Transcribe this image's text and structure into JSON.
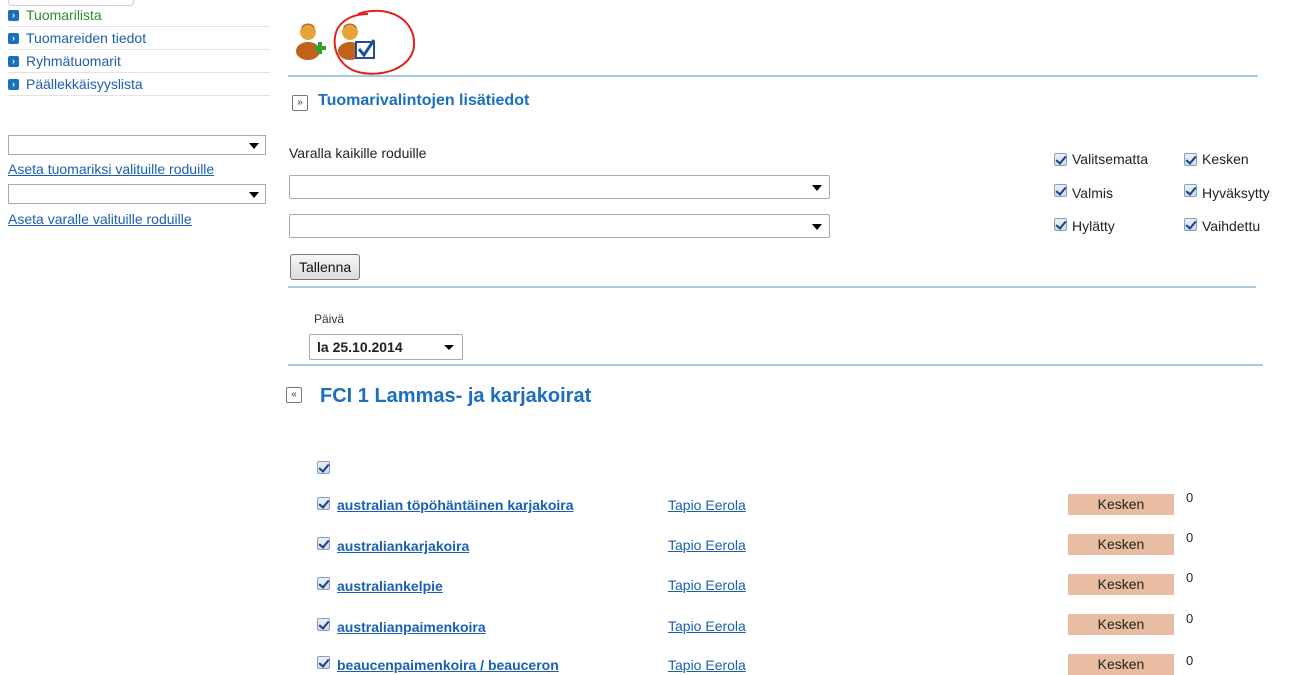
{
  "sidebar": {
    "items": [
      {
        "label": "Tuomarilista",
        "active": true
      },
      {
        "label": "Tuomareiden tiedot",
        "active": false
      },
      {
        "label": "Ryhmätuomarit",
        "active": false
      },
      {
        "label": "Päällekkäisyyslista",
        "active": false
      }
    ],
    "select1_value": "",
    "link1": "Aseta tuomariksi valituille roduille",
    "select2_value": "",
    "link2": "Aseta varalle valituille roduille"
  },
  "toolbar": {
    "icons": [
      "add-judge-icon",
      "judge-approve-icon"
    ]
  },
  "details": {
    "title": "Tuomarivalintojen lisätiedot",
    "reserve_label": "Varalla kaikille roduille",
    "select1_value": "",
    "select2_value": "",
    "save_label": "Tallenna"
  },
  "filters": [
    {
      "label": "Valitsematta",
      "checked": true
    },
    {
      "label": "Kesken",
      "checked": true
    },
    {
      "label": "Valmis",
      "checked": true
    },
    {
      "label": "Hyväksytty",
      "checked": true
    },
    {
      "label": "Hylätty",
      "checked": true
    },
    {
      "label": "Vaihdettu",
      "checked": true
    }
  ],
  "day": {
    "label": "Päivä",
    "value": "la 25.10.2014"
  },
  "group": {
    "title": "FCI 1 Lammas- ja karjakoirat",
    "rows": [
      {
        "breed": "australian töpöhäntäinen karjakoira",
        "judge": "Tapio Eerola",
        "status": "Kesken",
        "count": "0"
      },
      {
        "breed": "australiankarjakoira",
        "judge": "Tapio Eerola",
        "status": "Kesken",
        "count": "0"
      },
      {
        "breed": "australiankelpie",
        "judge": "Tapio Eerola",
        "status": "Kesken",
        "count": "0"
      },
      {
        "breed": "australianpaimenkoira",
        "judge": "Tapio Eerola",
        "status": "Kesken",
        "count": "0"
      },
      {
        "breed": "beaucenpaimenkoira / beauceron",
        "judge": "Tapio Eerola",
        "status": "Kesken",
        "count": "0"
      }
    ]
  },
  "colors": {
    "link": "#1a5fb4",
    "active_nav": "#2e8b2e",
    "divider": "#a9cbe6",
    "status_bg": "#e8bca0",
    "annotation_circle": "#e0201c"
  }
}
